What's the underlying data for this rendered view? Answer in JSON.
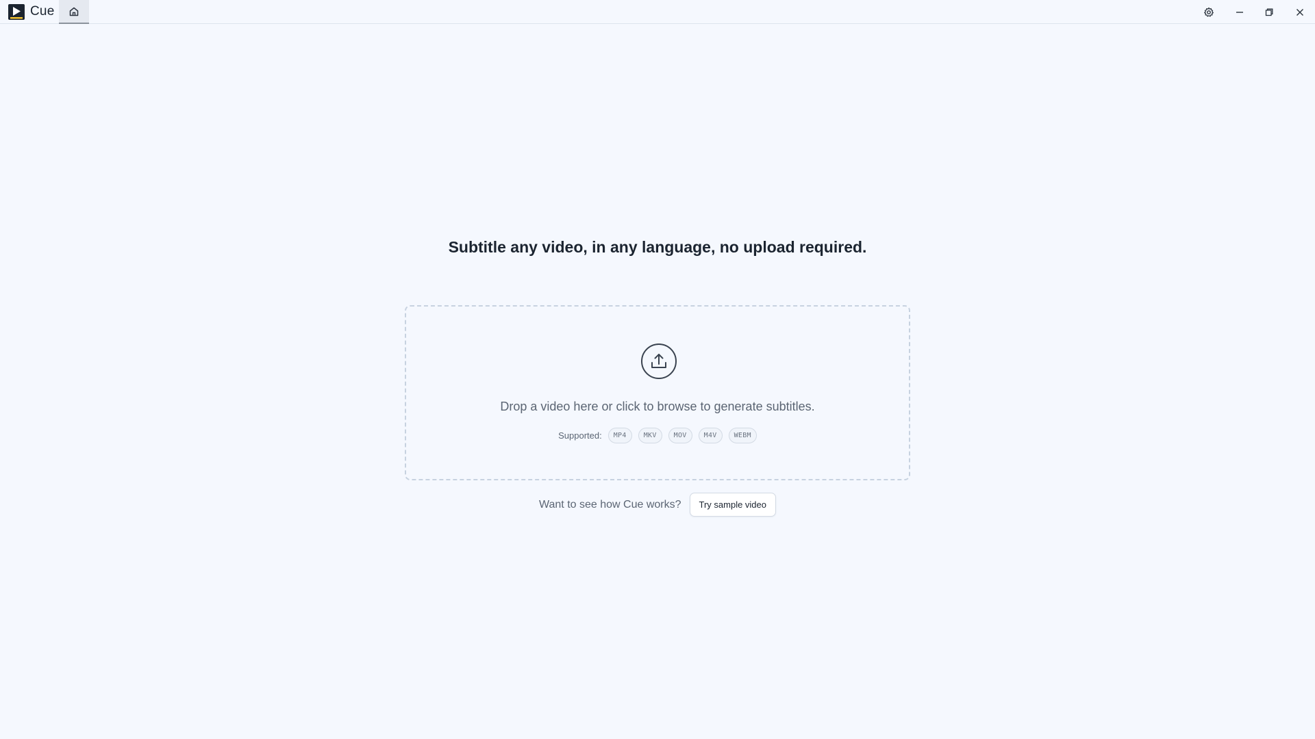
{
  "app": {
    "name": "Cue",
    "logo_icon": "play-logo-icon",
    "home_tab_icon": "home-icon"
  },
  "window_controls": {
    "settings_icon": "gear-icon",
    "minimize_icon": "minimize-icon",
    "restore_icon": "restore-icon",
    "close_icon": "close-icon"
  },
  "main": {
    "headline": "Subtitle any video, in any language, no upload required.",
    "dropzone": {
      "icon": "upload-icon",
      "text": "Drop a video here or click to browse to generate subtitles.",
      "supported_label": "Supported:",
      "formats": [
        "MP4",
        "MKV",
        "MOV",
        "M4V",
        "WEBM"
      ]
    },
    "sample": {
      "prompt": "Want to see how Cue works?",
      "button_label": "Try sample video"
    }
  },
  "colors": {
    "background": "#f5f8fe",
    "text_primary": "#1b2430",
    "text_secondary": "#5b6573",
    "border": "#c7d2e0",
    "logo_accent": "#f2c230"
  }
}
